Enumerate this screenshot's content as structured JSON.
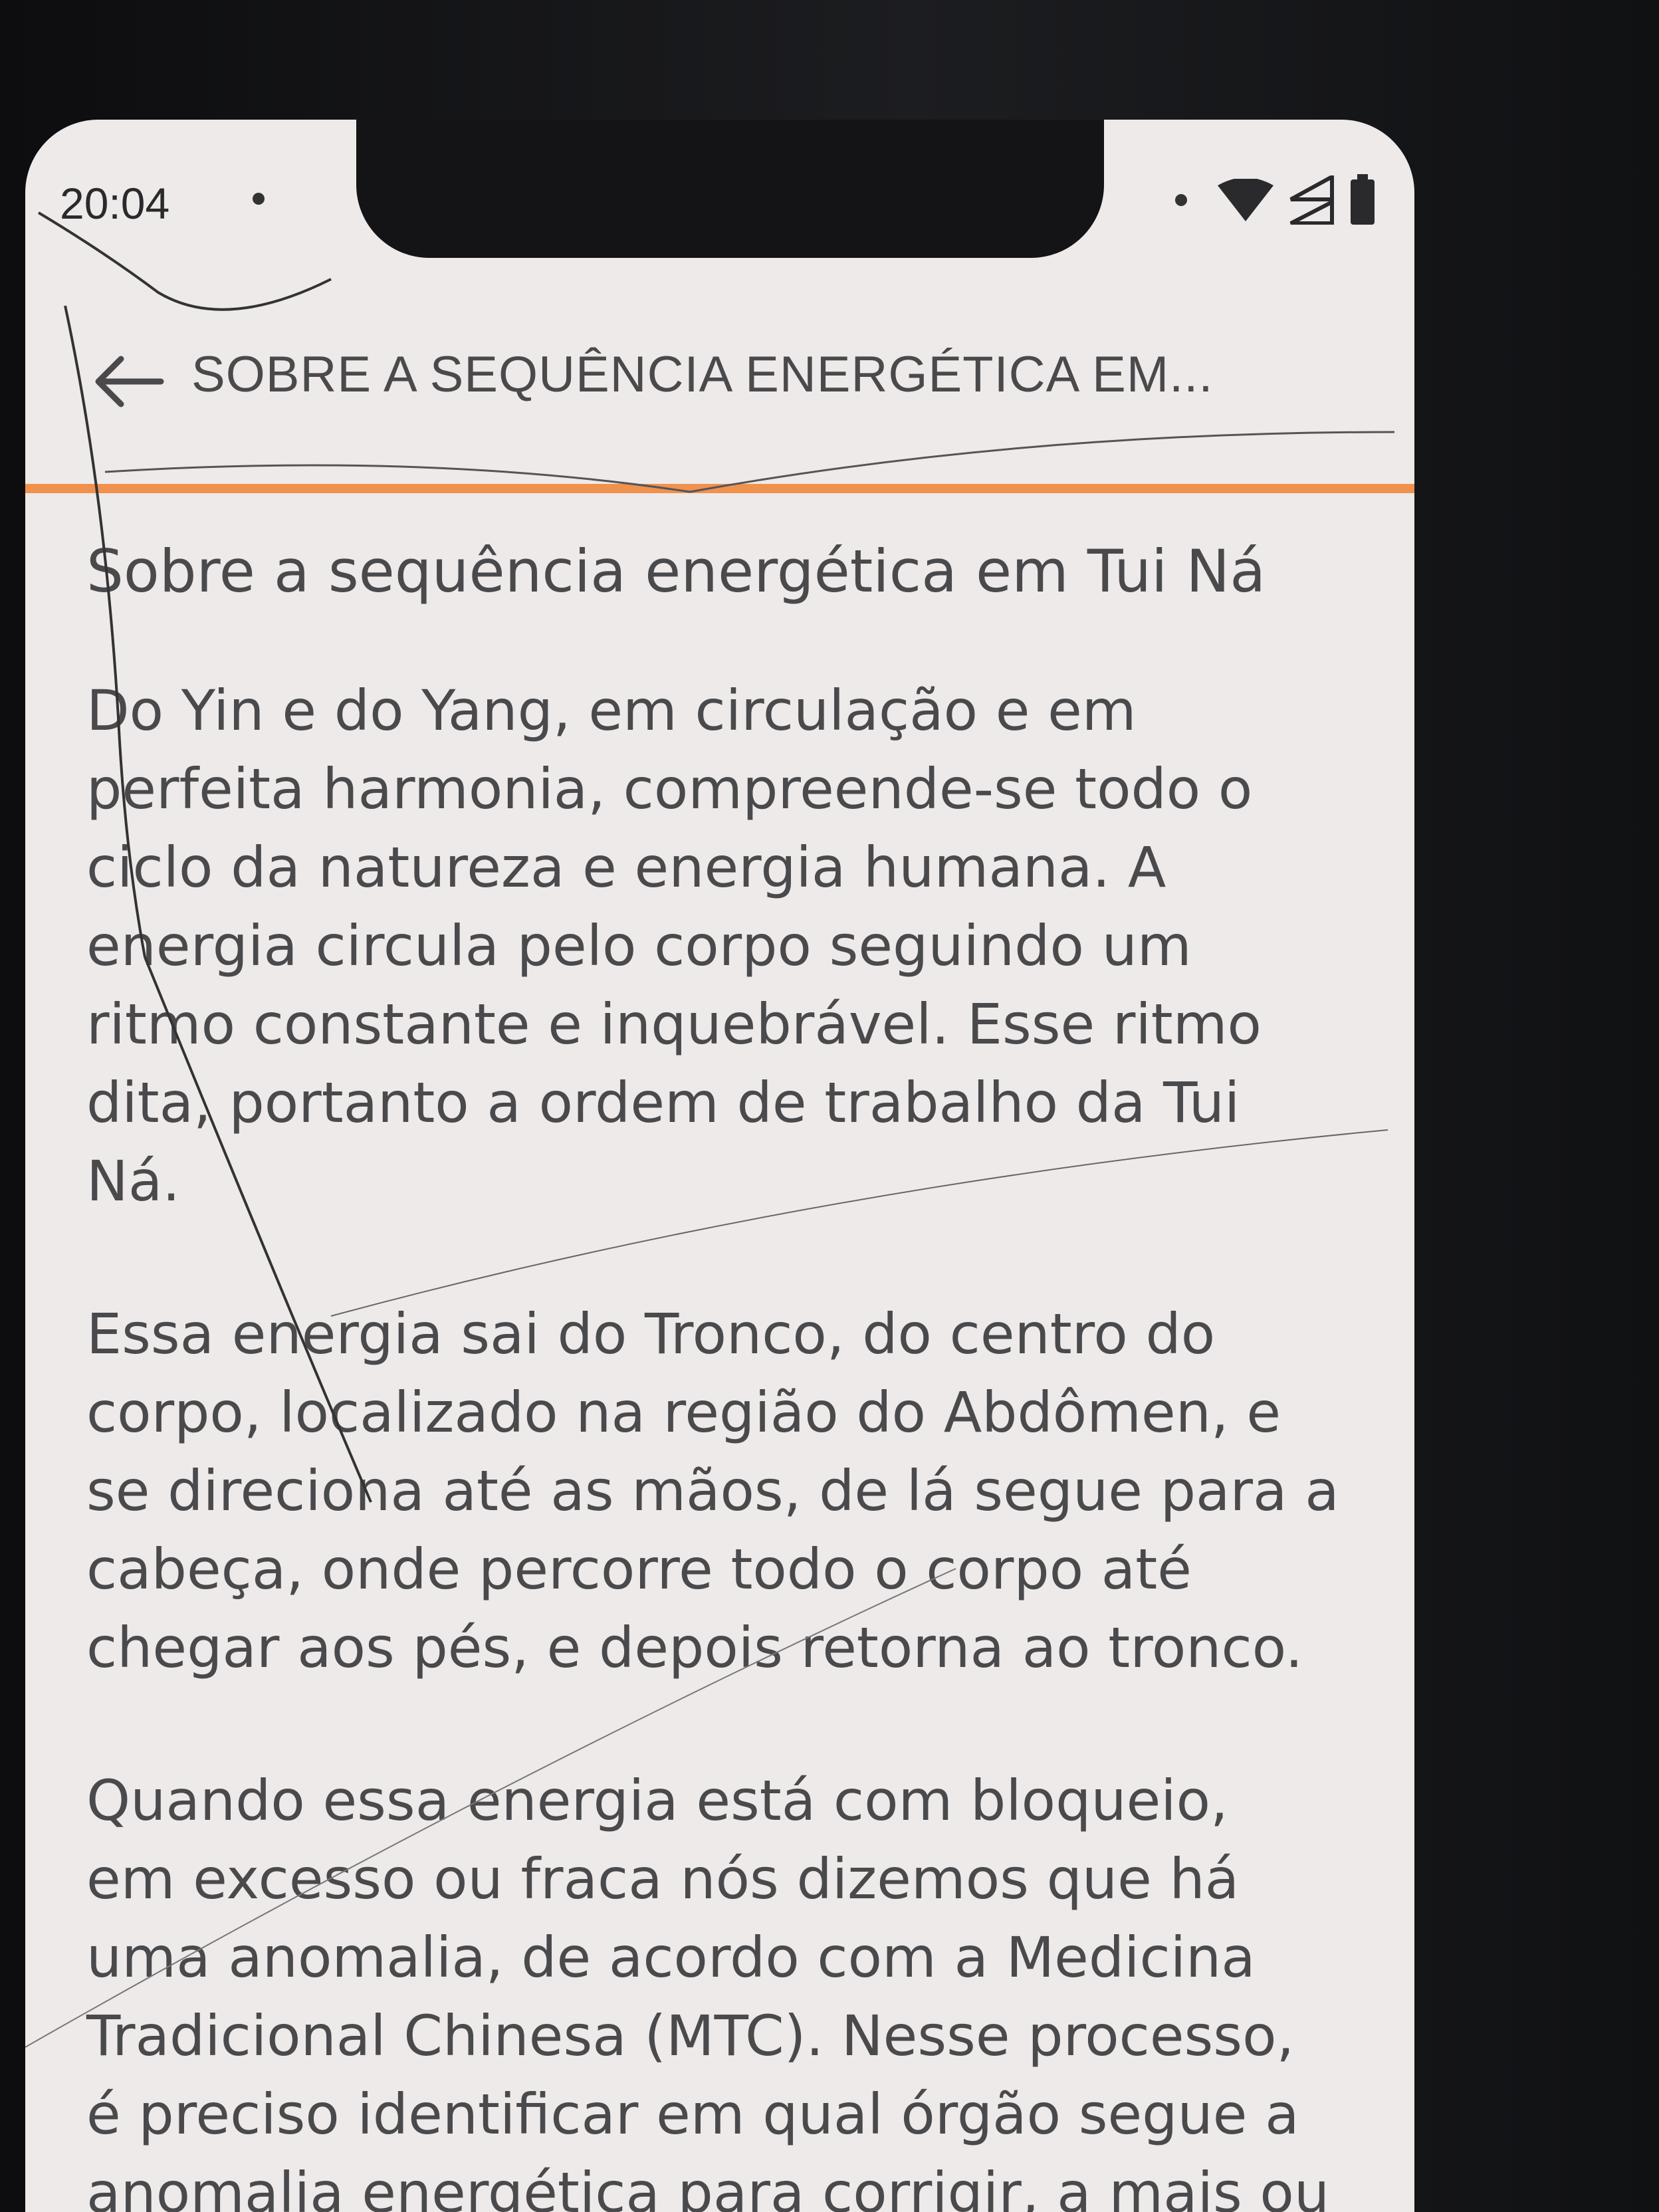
{
  "status_bar": {
    "time": "20:04"
  },
  "header": {
    "title": "SOBRE A SEQUÊNCIA ENERGÉTICA EM...",
    "back_icon": "arrow-left-icon",
    "accent_color": "#f0914e"
  },
  "article": {
    "heading": "Sobre a sequência energética em Tui Ná",
    "paragraphs": [
      "Do Yin e do Yang, em circulação e em\nperfeita harmonia, compreende-se todo o\nciclo da natureza e energia humana. A\nenergia circula pelo corpo seguindo um\nritmo constante e inquebrável. Esse ritmo\ndita, portanto a ordem de trabalho da Tui\nNá.",
      "Essa energia sai do Tronco, do centro do\ncorpo, localizado na região do Abdômen, e\nse direciona até as mãos, de lá segue para a\ncabeça, onde percorre todo o corpo até\nchegar aos pés, e depois retorna ao tronco.",
      "Quando essa energia está com bloqueio,\nem excesso ou fraca nós dizemos que há\numa anomalia, de acordo com a Medicina\nTradicional Chinesa (MTC). Nesse processo,\né preciso identificar em qual órgão segue a\nanomalia energética para corrigir, a mais ou"
    ]
  }
}
